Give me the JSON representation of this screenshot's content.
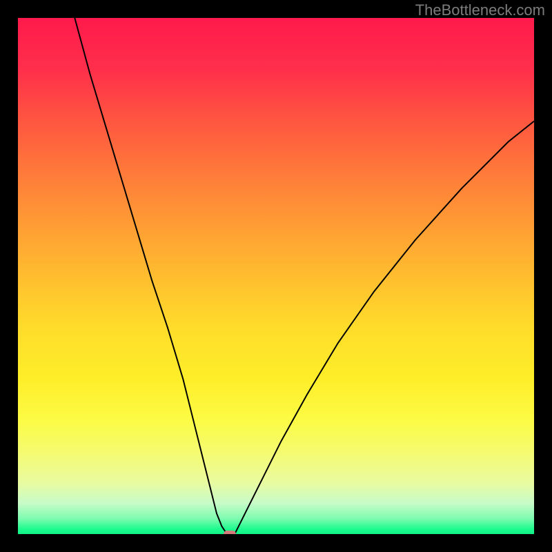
{
  "attribution": "TheBottleneck.com",
  "chart_data": {
    "type": "line",
    "title": "",
    "xlabel": "",
    "ylabel": "",
    "xlim": [
      0,
      100
    ],
    "ylim": [
      0,
      100
    ],
    "grid": false,
    "legend": false,
    "background_gradient": {
      "direction": "vertical",
      "stops": [
        {
          "pos": 0,
          "color": "#ff1a4b"
        },
        {
          "pos": 50,
          "color": "#ffbd2f"
        },
        {
          "pos": 80,
          "color": "#fcfb45"
        },
        {
          "pos": 100,
          "color": "#10f388"
        }
      ]
    },
    "series": [
      {
        "name": "left-branch",
        "x": [
          11,
          14,
          17,
          20,
          23,
          26,
          29,
          32,
          34,
          36,
          37.5,
          38.5,
          39.5,
          40.5
        ],
        "y": [
          100,
          89,
          79,
          69,
          59,
          49,
          40,
          30,
          22,
          14,
          8,
          4,
          1.5,
          0
        ]
      },
      {
        "name": "right-branch",
        "x": [
          42,
          44,
          47,
          51,
          56,
          62,
          69,
          77,
          86,
          95,
          100
        ],
        "y": [
          0,
          4,
          10,
          18,
          27,
          37,
          47,
          57,
          67,
          76,
          80
        ]
      }
    ],
    "minimum_marker": {
      "x": 41,
      "y": 0,
      "color": "#d47a7a"
    }
  }
}
